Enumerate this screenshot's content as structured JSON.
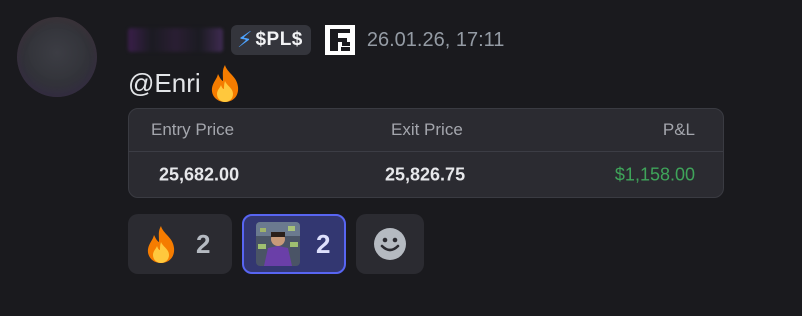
{
  "message": {
    "tag": {
      "icon": "lightning-bolt-icon",
      "text": "$PL$"
    },
    "server_icon": "server-logo-icon",
    "timestamp": "26.01.26, 17:11",
    "content": {
      "mention": "@Enri",
      "emoji": "fire-icon"
    }
  },
  "trade_card": {
    "headers": {
      "entry": "Entry Price",
      "exit": "Exit Price",
      "pnl": "P&L"
    },
    "row": {
      "entry": "25,682.00",
      "exit": "25,826.75",
      "pnl": "$1,158.00"
    },
    "colors": {
      "pnl_positive": "#3fa45a"
    }
  },
  "reactions": [
    {
      "emoji": "fire-icon",
      "count": "2",
      "active": false
    },
    {
      "emoji": "custom-emoji-thumbnail",
      "count": "2",
      "active": true
    },
    {
      "emoji": "add-reaction-icon",
      "count": null,
      "active": false
    }
  ],
  "colors": {
    "background": "#1a1a1e",
    "accent": "#5865f2",
    "mention_text": "#e3e5e8"
  }
}
